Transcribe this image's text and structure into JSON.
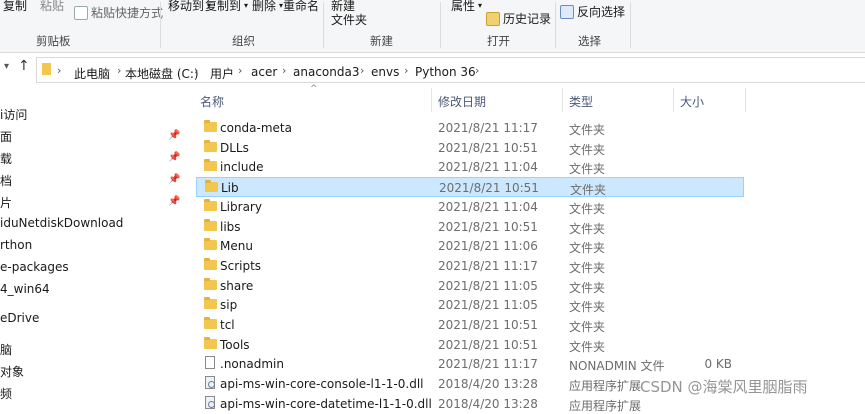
{
  "ribbon": {
    "copy": "复制",
    "paste": "粘贴",
    "paste_shortcut": "粘贴快捷方式",
    "move_to": "移动到",
    "copy_to": "复制到",
    "delete": "删除",
    "rename": "重命名",
    "new_folder_line1": "新建",
    "new_folder_line2": "文件夹",
    "properties": "属性",
    "history": "历史记录",
    "invert_selection": "反向选择",
    "groups": {
      "clipboard": "剪贴板",
      "organize": "组织",
      "new": "新建",
      "open": "打开",
      "select": "选择"
    }
  },
  "address": {
    "crumbs": [
      "此电脑",
      "本地磁盘 (C:)",
      "用户",
      "acer",
      "anaconda3",
      "envs",
      "Python 36"
    ]
  },
  "nav": {
    "items": [
      "i访问",
      "面",
      "载",
      "档",
      "片",
      "iduNetdiskDownload",
      "rthon",
      "e-packages",
      "4_win64",
      "eDrive",
      "脑",
      "对象",
      "频"
    ]
  },
  "columns": {
    "name": "名称",
    "date": "修改日期",
    "type": "类型",
    "size": "大小"
  },
  "files": [
    {
      "name": "conda-meta",
      "date": "2021/8/21 11:17",
      "type": "文件夹",
      "size": "",
      "kind": "folder"
    },
    {
      "name": "DLLs",
      "date": "2021/8/21 10:51",
      "type": "文件夹",
      "size": "",
      "kind": "folder"
    },
    {
      "name": "include",
      "date": "2021/8/21 11:04",
      "type": "文件夹",
      "size": "",
      "kind": "folder"
    },
    {
      "name": "Lib",
      "date": "2021/8/21 10:51",
      "type": "文件夹",
      "size": "",
      "kind": "folder",
      "selected": true
    },
    {
      "name": "Library",
      "date": "2021/8/21 11:04",
      "type": "文件夹",
      "size": "",
      "kind": "folder"
    },
    {
      "name": "libs",
      "date": "2021/8/21 10:51",
      "type": "文件夹",
      "size": "",
      "kind": "folder"
    },
    {
      "name": "Menu",
      "date": "2021/8/21 11:06",
      "type": "文件夹",
      "size": "",
      "kind": "folder"
    },
    {
      "name": "Scripts",
      "date": "2021/8/21 11:17",
      "type": "文件夹",
      "size": "",
      "kind": "folder"
    },
    {
      "name": "share",
      "date": "2021/8/21 11:05",
      "type": "文件夹",
      "size": "",
      "kind": "folder"
    },
    {
      "name": "sip",
      "date": "2021/8/21 11:05",
      "type": "文件夹",
      "size": "",
      "kind": "folder"
    },
    {
      "name": "tcl",
      "date": "2021/8/21 10:51",
      "type": "文件夹",
      "size": "",
      "kind": "folder"
    },
    {
      "name": "Tools",
      "date": "2021/8/21 10:51",
      "type": "文件夹",
      "size": "",
      "kind": "folder"
    },
    {
      "name": ".nonadmin",
      "date": "2021/8/21 11:17",
      "type": "NONADMIN 文件",
      "size": "0 KB",
      "kind": "file"
    },
    {
      "name": "api-ms-win-core-console-l1-1-0.dll",
      "date": "2018/4/20 13:28",
      "type": "应用程序扩展",
      "size": "",
      "kind": "dll"
    },
    {
      "name": "api-ms-win-core-datetime-l1-1-0.dll",
      "date": "2018/4/20 13:28",
      "type": "应用程序扩展",
      "size": "",
      "kind": "dll"
    }
  ],
  "watermark": "CSDN @海棠风里胭脂雨",
  "colors": {
    "selection_bg": "#cce8ff",
    "selection_border": "#99d1ff",
    "folder": "#f3c64f",
    "ribbon_bg": "#f5f6f7"
  }
}
